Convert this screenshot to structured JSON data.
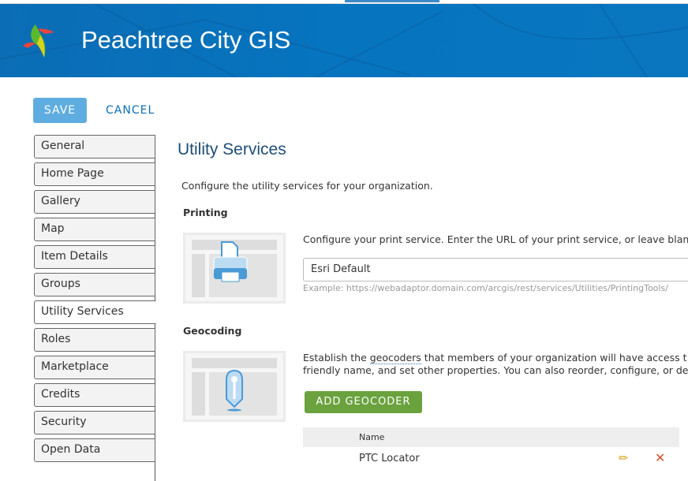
{
  "header": {
    "title": "Peachtree City GIS",
    "brand_color": "#0674bf"
  },
  "toolbar": {
    "save_label": "SAVE",
    "cancel_label": "CANCEL"
  },
  "sidebar": {
    "active": "Utility Services",
    "items": [
      {
        "label": "General"
      },
      {
        "label": "Home Page"
      },
      {
        "label": "Gallery"
      },
      {
        "label": "Map"
      },
      {
        "label": "Item Details"
      },
      {
        "label": "Groups"
      },
      {
        "label": "Utility Services"
      },
      {
        "label": "Roles"
      },
      {
        "label": "Marketplace"
      },
      {
        "label": "Credits"
      },
      {
        "label": "Security"
      },
      {
        "label": "Open Data"
      }
    ]
  },
  "main": {
    "title": "Utility Services",
    "description": "Configure the utility services for your organization.",
    "printing": {
      "heading": "Printing",
      "text": "Configure your print service. Enter the URL of your print service, or leave blan",
      "value": "Esri Default",
      "hint": "Example: https://webadaptor.domain.com/arcgis/rest/services/Utilities/PrintingTools/"
    },
    "geocoding": {
      "heading": "Geocoding",
      "text_pre": "Establish the ",
      "text_link": "geocoders",
      "text_post": " that members of your organization will have access t",
      "text_line2": "friendly name, and set other properties. You can also reorder, configure, or de",
      "add_label": "ADD GEOCODER",
      "table": {
        "header": "Name",
        "rows": [
          {
            "name": "PTC Locator"
          }
        ]
      }
    }
  }
}
